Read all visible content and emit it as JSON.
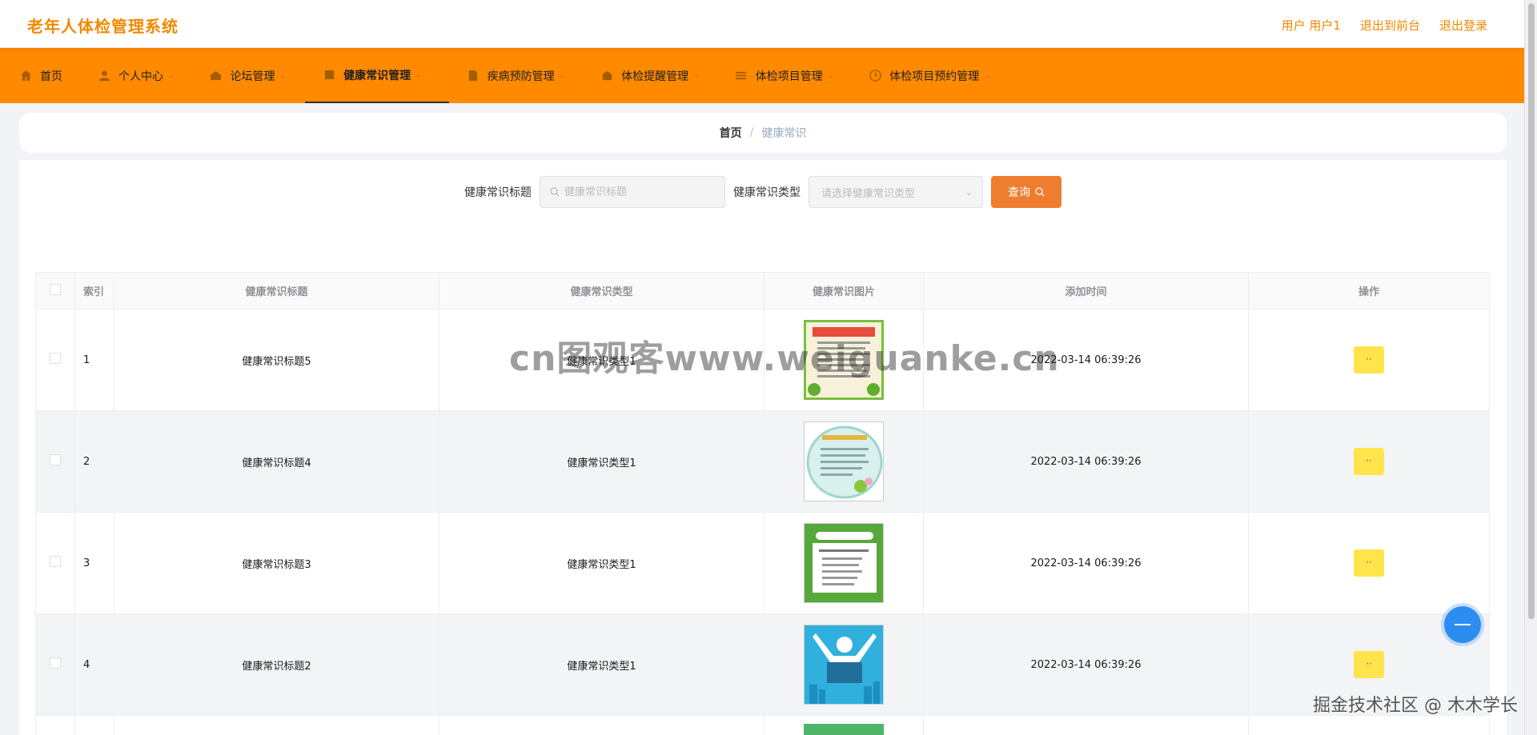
{
  "header": {
    "title": "老年人体检管理系统",
    "user_label": "用户 用户1",
    "to_front_label": "退出到前台",
    "logout_label": "退出登录"
  },
  "nav": {
    "items": [
      {
        "label": "首页",
        "icon": "home-icon"
      },
      {
        "label": "个人中心",
        "icon": "user-icon"
      },
      {
        "label": "论坛管理",
        "icon": "forum-icon"
      },
      {
        "label": "健康常识管理",
        "icon": "book-icon",
        "active": true
      },
      {
        "label": "疾病预防管理",
        "icon": "document-icon"
      },
      {
        "label": "体检提醒管理",
        "icon": "bell-icon"
      },
      {
        "label": "体检项目管理",
        "icon": "list-icon"
      },
      {
        "label": "体检项目预约管理",
        "icon": "clock-icon"
      }
    ]
  },
  "breadcrumb": {
    "home": "首页",
    "separator": "/",
    "current": "健康常识"
  },
  "search": {
    "title_label": "健康常识标题",
    "title_placeholder": "健康常识标题",
    "type_label": "健康常识类型",
    "type_placeholder": "请选择健康常识类型",
    "query_label": "查询"
  },
  "table": {
    "headers": [
      "索引",
      "健康常识标题",
      "健康常识类型",
      "健康常识图片",
      "添加时间",
      "操作"
    ],
    "rows": [
      {
        "index": "1",
        "title": "健康常识标题5",
        "type": "健康常识类型1",
        "time": "2022-03-14 06:39:26",
        "op": "··"
      },
      {
        "index": "2",
        "title": "健康常识标题4",
        "type": "健康常识类型1",
        "time": "2022-03-14 06:39:26",
        "op": "··"
      },
      {
        "index": "3",
        "title": "健康常识标题3",
        "type": "健康常识类型1",
        "time": "2022-03-14 06:39:26",
        "op": "··"
      },
      {
        "index": "4",
        "title": "健康常识标题2",
        "type": "健康常识类型1",
        "time": "2022-03-14 06:39:26",
        "op": "··"
      }
    ]
  },
  "overlay": {
    "watermark": "cn图观客www.weiguanke.cn",
    "footer": "掘金技术社区 @ 木木学长"
  },
  "colors": {
    "brand": "#f08a00",
    "nav_bg": "#ff8a00",
    "query_btn": "#ef7d2f",
    "op_btn": "#ffe44b",
    "float_btn": "#2d8cf0"
  }
}
